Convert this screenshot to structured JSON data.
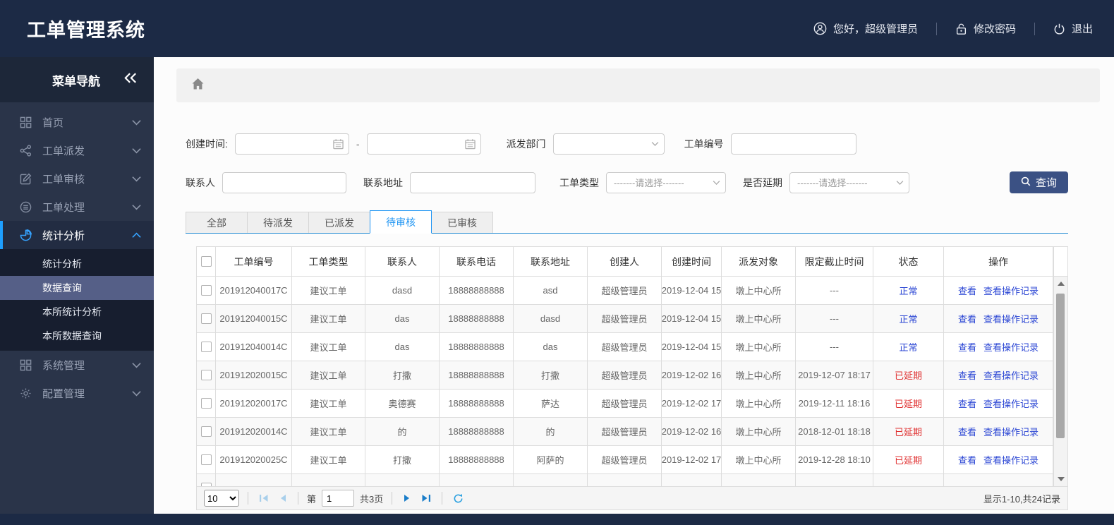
{
  "colors": {
    "accent_blue": "#1e9fff",
    "link_blue": "#2b46d4",
    "status_normal_color": "#2b46d4",
    "status_delayed_color": "#e03131",
    "search_button_bg": "#3b5184"
  },
  "topbar": {
    "title": "工单管理系统",
    "greeting": "您好，超级管理员",
    "change_password": "修改密码",
    "logout": "退出"
  },
  "sidebar": {
    "header": "菜单导航",
    "items": [
      {
        "label": "首页",
        "icon": "grid-icon"
      },
      {
        "label": "工单派发",
        "icon": "share-icon"
      },
      {
        "label": "工单审核",
        "icon": "edit-icon"
      },
      {
        "label": "工单处理",
        "icon": "process-icon"
      },
      {
        "label": "统计分析",
        "icon": "pie-chart-icon",
        "expanded": true
      },
      {
        "label": "系统管理",
        "icon": "modules-icon"
      },
      {
        "label": "配置管理",
        "icon": "gear-icon"
      }
    ],
    "submenu": {
      "items": [
        "统计分析",
        "数据查询",
        "本所统计分析",
        "本所数据查询"
      ],
      "active": "数据查询"
    }
  },
  "filters": {
    "create_time_label": "创建时间:",
    "range_separator": "-",
    "dispatch_dept_label": "派发部门",
    "order_no_label": "工单编号",
    "contact_label": "联系人",
    "address_label": "联系地址",
    "order_type_label": "工单类型",
    "delay_label": "是否延期",
    "select_placeholder": "-------请选择-------",
    "search_button": "查询"
  },
  "tabs": {
    "items": [
      "全部",
      "待派发",
      "已派发",
      "待审核",
      "已审核"
    ],
    "active": "待审核"
  },
  "table": {
    "columns": [
      "工单编号",
      "工单类型",
      "联系人",
      "联系电话",
      "联系地址",
      "创建人",
      "创建时间",
      "派发对象",
      "限定截止时间",
      "状态",
      "操作"
    ],
    "actions": [
      "查看",
      "查看操作记录"
    ],
    "rows": [
      {
        "no": "201912040017C",
        "type": "建议工单",
        "contact": "dasd",
        "phone": "18888888888",
        "addr": "asd",
        "creator": "超级管理员",
        "created": "2019-12-04 15",
        "target": "墩上中心所",
        "deadline": "---",
        "status": "正常",
        "status_type": "normal"
      },
      {
        "no": "201912040015C",
        "type": "建议工单",
        "contact": "das",
        "phone": "18888888888",
        "addr": "dasd",
        "creator": "超级管理员",
        "created": "2019-12-04 15",
        "target": "墩上中心所",
        "deadline": "---",
        "status": "正常",
        "status_type": "normal"
      },
      {
        "no": "201912040014C",
        "type": "建议工单",
        "contact": "das",
        "phone": "18888888888",
        "addr": "das",
        "creator": "超级管理员",
        "created": "2019-12-04 15",
        "target": "墩上中心所",
        "deadline": "---",
        "status": "正常",
        "status_type": "normal"
      },
      {
        "no": "201912020015C",
        "type": "建议工单",
        "contact": "打撒",
        "phone": "18888888888",
        "addr": "打撒",
        "creator": "超级管理员",
        "created": "2019-12-02 16",
        "target": "墩上中心所",
        "deadline": "2019-12-07 18:17",
        "status": "已延期",
        "status_type": "delayed"
      },
      {
        "no": "201912020017C",
        "type": "建议工单",
        "contact": "奥德赛",
        "phone": "18888888888",
        "addr": "萨达",
        "creator": "超级管理员",
        "created": "2019-12-02 17",
        "target": "墩上中心所",
        "deadline": "2019-12-11 18:16",
        "status": "已延期",
        "status_type": "delayed"
      },
      {
        "no": "201912020014C",
        "type": "建议工单",
        "contact": "的",
        "phone": "18888888888",
        "addr": "的",
        "creator": "超级管理员",
        "created": "2019-12-02 16",
        "target": "墩上中心所",
        "deadline": "2018-12-01 18:18",
        "status": "已延期",
        "status_type": "delayed"
      },
      {
        "no": "201912020025C",
        "type": "建议工单",
        "contact": "打撒",
        "phone": "18888888888",
        "addr": "阿萨的",
        "creator": "超级管理员",
        "created": "2019-12-02 17",
        "target": "墩上中心所",
        "deadline": "2019-12-28 18:10",
        "status": "已延期",
        "status_type": "delayed"
      }
    ]
  },
  "pagination": {
    "page_size": "10",
    "page_prefix": "第",
    "current_page": "1",
    "total_pages": "共3页",
    "summary": "显示1-10,共24记录"
  }
}
